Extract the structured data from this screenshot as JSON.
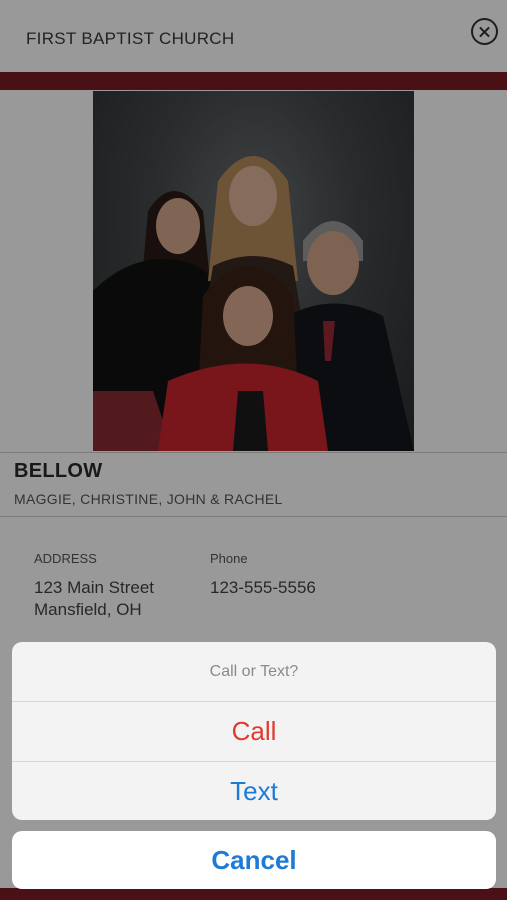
{
  "header": {
    "title": "FIRST BAPTIST CHURCH",
    "close_icon": "close-circle-icon"
  },
  "colors": {
    "accent": "#7a1c24",
    "destructive": "#e03a2f",
    "link": "#1d7bd8"
  },
  "profile": {
    "family_name": "BELLOW",
    "members": "MAGGIE, CHRISTINE, JOHN & RACHEL",
    "address_label": "ADDRESS",
    "address_line1": "123 Main Street",
    "address_line2": "Mansfield, OH",
    "phone_label": "Phone",
    "phone": "123-555-5556"
  },
  "action_sheet": {
    "title": "Call or Text?",
    "call_label": "Call",
    "text_label": "Text",
    "cancel_label": "Cancel"
  }
}
